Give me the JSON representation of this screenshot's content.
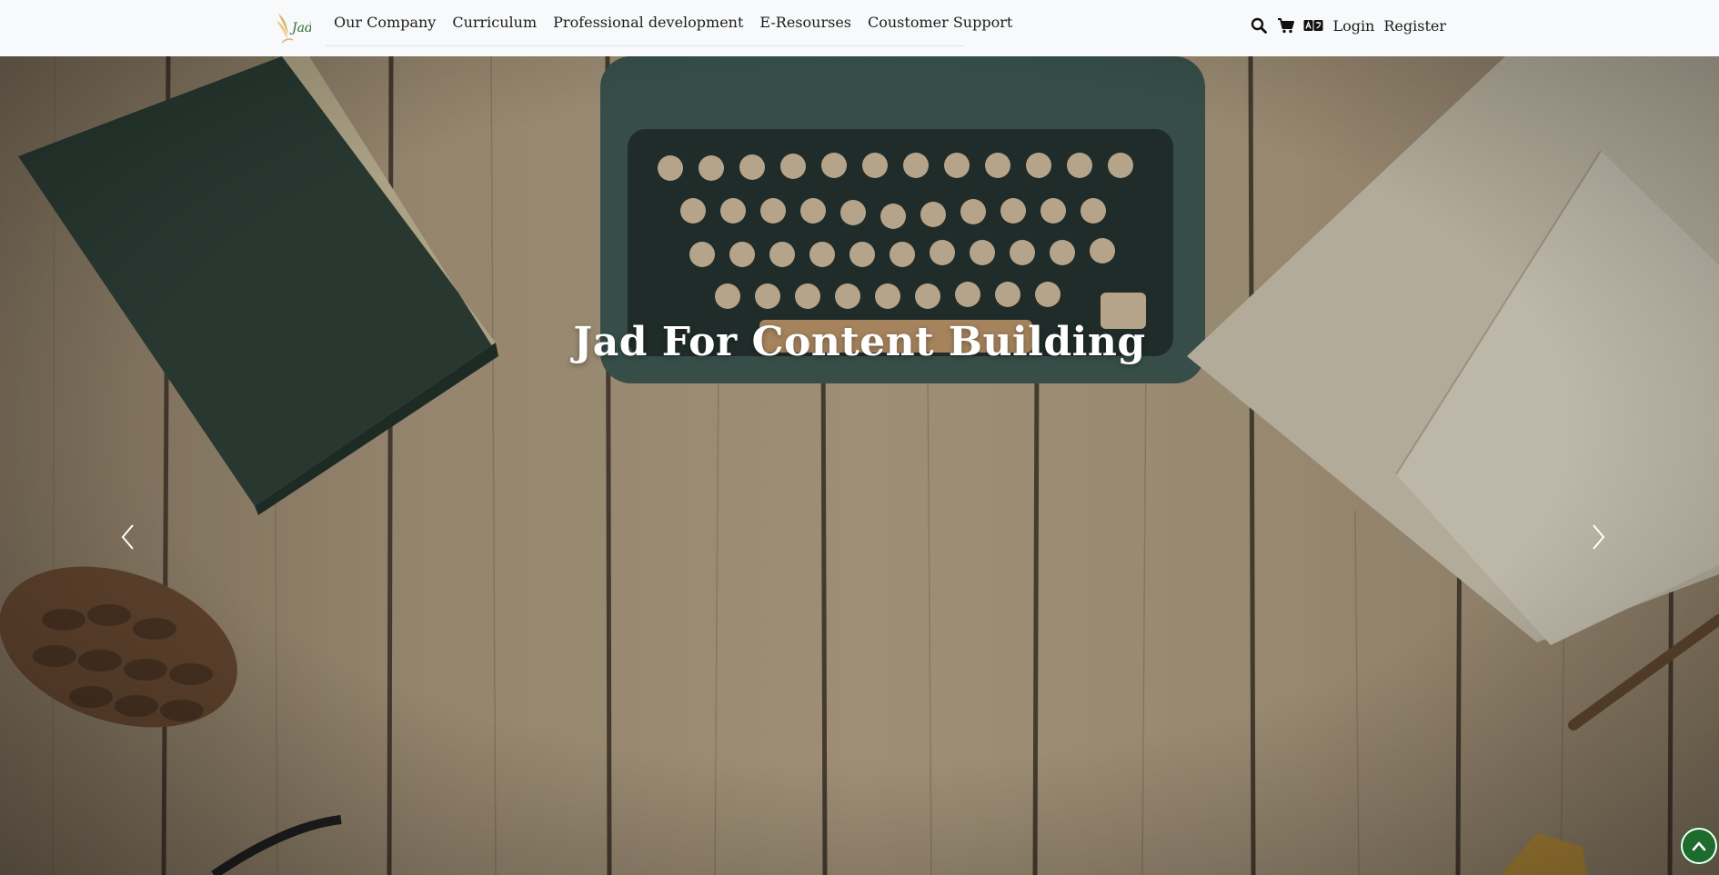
{
  "brand": {
    "logo_text": "Jad"
  },
  "nav": {
    "links": [
      {
        "label": "Our Company"
      },
      {
        "label": "Curriculum"
      },
      {
        "label": "Professional development"
      },
      {
        "label": "E-Resourses"
      },
      {
        "label": "Coustomer Support"
      }
    ],
    "login_label": "Login",
    "register_label": "Register",
    "icons": [
      "search-icon",
      "cart-icon",
      "language-icon"
    ]
  },
  "hero": {
    "title": "Jad For Content Building"
  },
  "colors": {
    "accent": "#1e6b2e",
    "navbar_bg": "#f8f9fa",
    "hero_text": "#ffffff"
  }
}
